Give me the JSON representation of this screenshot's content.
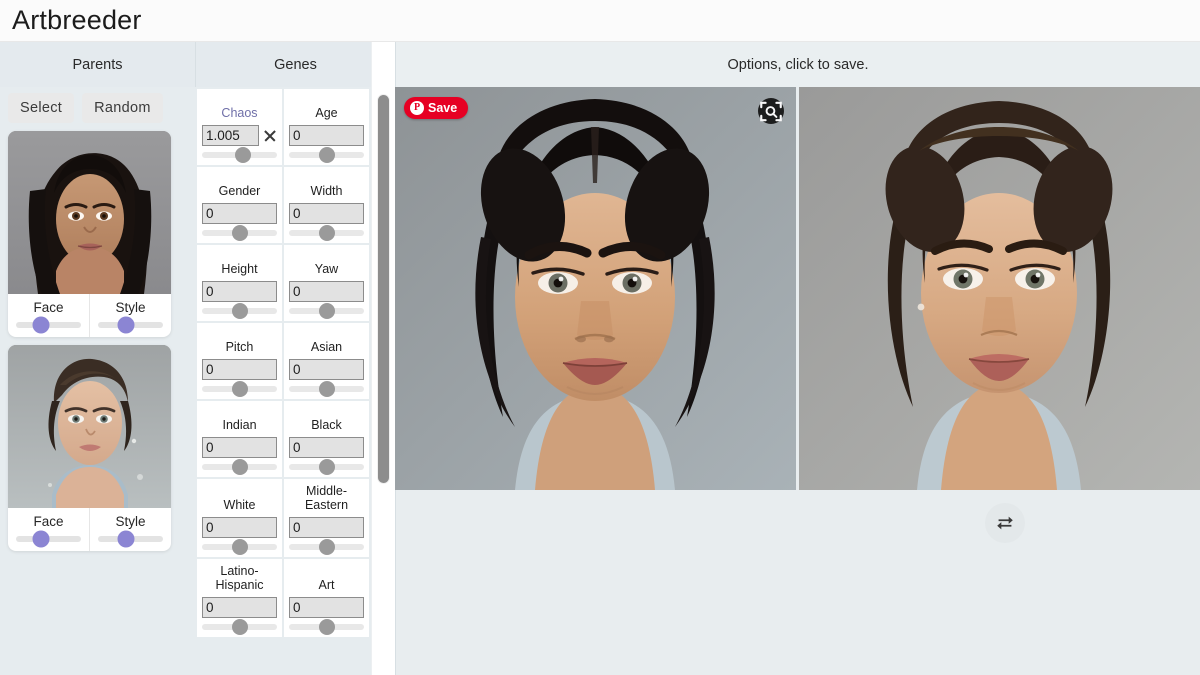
{
  "app": {
    "title": "Artbreeder"
  },
  "parents": {
    "header": "Parents",
    "buttons": {
      "select": "Select",
      "random": "Random"
    },
    "items": [
      {
        "name": "parent-1",
        "face_label": "Face",
        "style_label": "Style",
        "face_value": 38,
        "style_value": 43
      },
      {
        "name": "parent-2",
        "face_label": "Face",
        "style_label": "Style",
        "face_value": 38,
        "style_value": 43
      }
    ],
    "slider_thumb_color": "#8b85d3"
  },
  "genes": {
    "header": "Genes",
    "clear_icon": "x-icon",
    "items": [
      {
        "label": "Chaos",
        "value": "1.005",
        "slider": 55,
        "accent": true,
        "has_clear": true
      },
      {
        "label": "Age",
        "value": "0",
        "slider": 50,
        "accent": false,
        "has_clear": false
      },
      {
        "label": "Gender",
        "value": "0",
        "slider": 50,
        "accent": false,
        "has_clear": false
      },
      {
        "label": "Width",
        "value": "0",
        "slider": 50,
        "accent": false,
        "has_clear": false
      },
      {
        "label": "Height",
        "value": "0",
        "slider": 50,
        "accent": false,
        "has_clear": false
      },
      {
        "label": "Yaw",
        "value": "0",
        "slider": 50,
        "accent": false,
        "has_clear": false
      },
      {
        "label": "Pitch",
        "value": "0",
        "slider": 50,
        "accent": false,
        "has_clear": false
      },
      {
        "label": "Asian",
        "value": "0",
        "slider": 50,
        "accent": false,
        "has_clear": false
      },
      {
        "label": "Indian",
        "value": "0",
        "slider": 50,
        "accent": false,
        "has_clear": false
      },
      {
        "label": "Black",
        "value": "0",
        "slider": 50,
        "accent": false,
        "has_clear": false
      },
      {
        "label": "White",
        "value": "0",
        "slider": 50,
        "accent": false,
        "has_clear": false
      },
      {
        "label": "Middle-Eastern",
        "value": "0",
        "slider": 50,
        "accent": false,
        "has_clear": false
      },
      {
        "label": "Latino-Hispanic",
        "value": "0",
        "slider": 50,
        "accent": false,
        "has_clear": false
      },
      {
        "label": "Art",
        "value": "0",
        "slider": 50,
        "accent": false,
        "has_clear": false
      }
    ],
    "scrollbar": {
      "thumb_color": "#8d8d8d"
    }
  },
  "main": {
    "header": "Options, click to save.",
    "pinterest": {
      "label": "Save",
      "icon": "pinterest-icon",
      "color": "#e60023"
    },
    "zoom_icon": "magnifier-icon",
    "swap_icon": "swap-arrows-icon"
  }
}
